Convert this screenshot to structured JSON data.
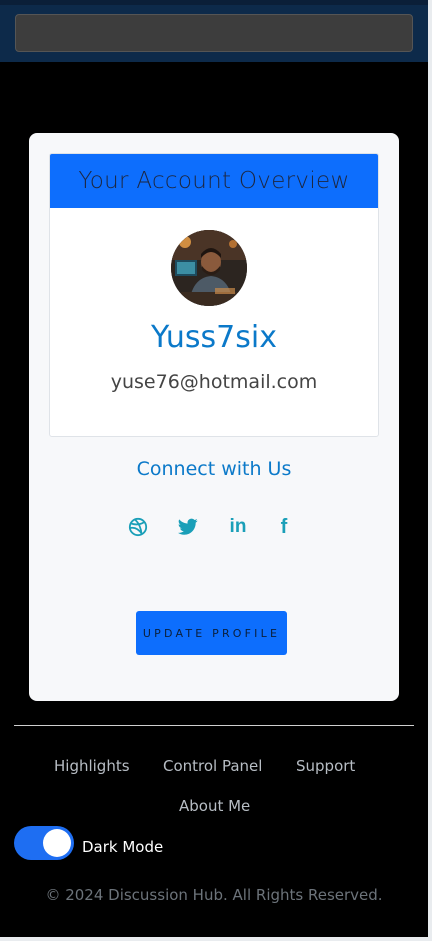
{
  "header": {
    "search_placeholder": ""
  },
  "account_card": {
    "title": "Your Account Overview",
    "avatar_icon": "user-photo-icon",
    "username": "Yuss7six",
    "email": "yuse76@hotmail.com"
  },
  "connect": {
    "heading": "Connect with Us",
    "socials": [
      {
        "name": "dribbble",
        "icon": "dribbble-icon"
      },
      {
        "name": "twitter",
        "icon": "twitter-icon"
      },
      {
        "name": "linkedin",
        "icon": "linkedin-icon",
        "glyph": "in"
      },
      {
        "name": "facebook",
        "icon": "facebook-icon",
        "glyph": "f"
      }
    ]
  },
  "actions": {
    "update_label": "UPDATE PROFILE"
  },
  "footer": {
    "links": [
      "Highlights",
      "Control Panel",
      "Support",
      "About Me"
    ],
    "dark_mode_label": "Dark Mode",
    "dark_mode_on": true,
    "copyright": "© 2024 Discussion Hub. All Rights Reserved."
  },
  "colors": {
    "accent_blue": "#0d6efd",
    "link_blue": "#0b79c9",
    "social_teal": "#1a9fb8",
    "background": "#000000"
  }
}
